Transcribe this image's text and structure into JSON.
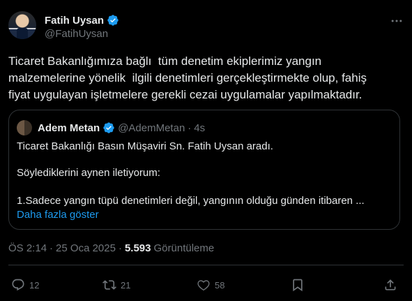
{
  "author": {
    "name": "Fatih Uysan",
    "handle": "@FatihUysan"
  },
  "icons": {
    "verified": "verified-badge-icon",
    "more": "more-options-icon",
    "reply": "reply-icon",
    "retweet": "retweet-icon",
    "like": "like-icon",
    "bookmark": "bookmark-icon",
    "share": "share-icon"
  },
  "colors": {
    "background": "#000000",
    "text": "#e7e9ea",
    "muted": "#71767b",
    "accent": "#1d9bf0",
    "border": "#2f3336"
  },
  "tweet": {
    "line1": "Ticaret Bakanlığımıza bağlı  tüm denetim ekiplerimiz yangın",
    "line2": "malzemelerine yönelik  ilgili denetimleri gerçekleştirmekte olup, fahiş",
    "line3": "fiyat uygulayan işletmelere gerekli cezai uygulamalar yapılmaktadır."
  },
  "quote": {
    "name": "Adem Metan",
    "handle": "@AdemMetan",
    "separator": "·",
    "time": "4s",
    "line1": "Ticaret Bakanlığı Basın Müşaviri Sn. Fatih Uysan aradı.",
    "line2": "Söylediklerini aynen iletiyorum:",
    "line3": "1.Sadece yangın tüpü denetimleri değil, yangının olduğu günden itibaren ...",
    "show_more": "Daha fazla göster"
  },
  "meta": {
    "time": "ÖS 2:14",
    "sep1": "·",
    "date": "25 Oca 2025",
    "sep2": "·",
    "views_count": "5.593",
    "views_label": "Görüntüleme"
  },
  "actions": {
    "reply_count": "12",
    "retweet_count": "21",
    "like_count": "58"
  }
}
